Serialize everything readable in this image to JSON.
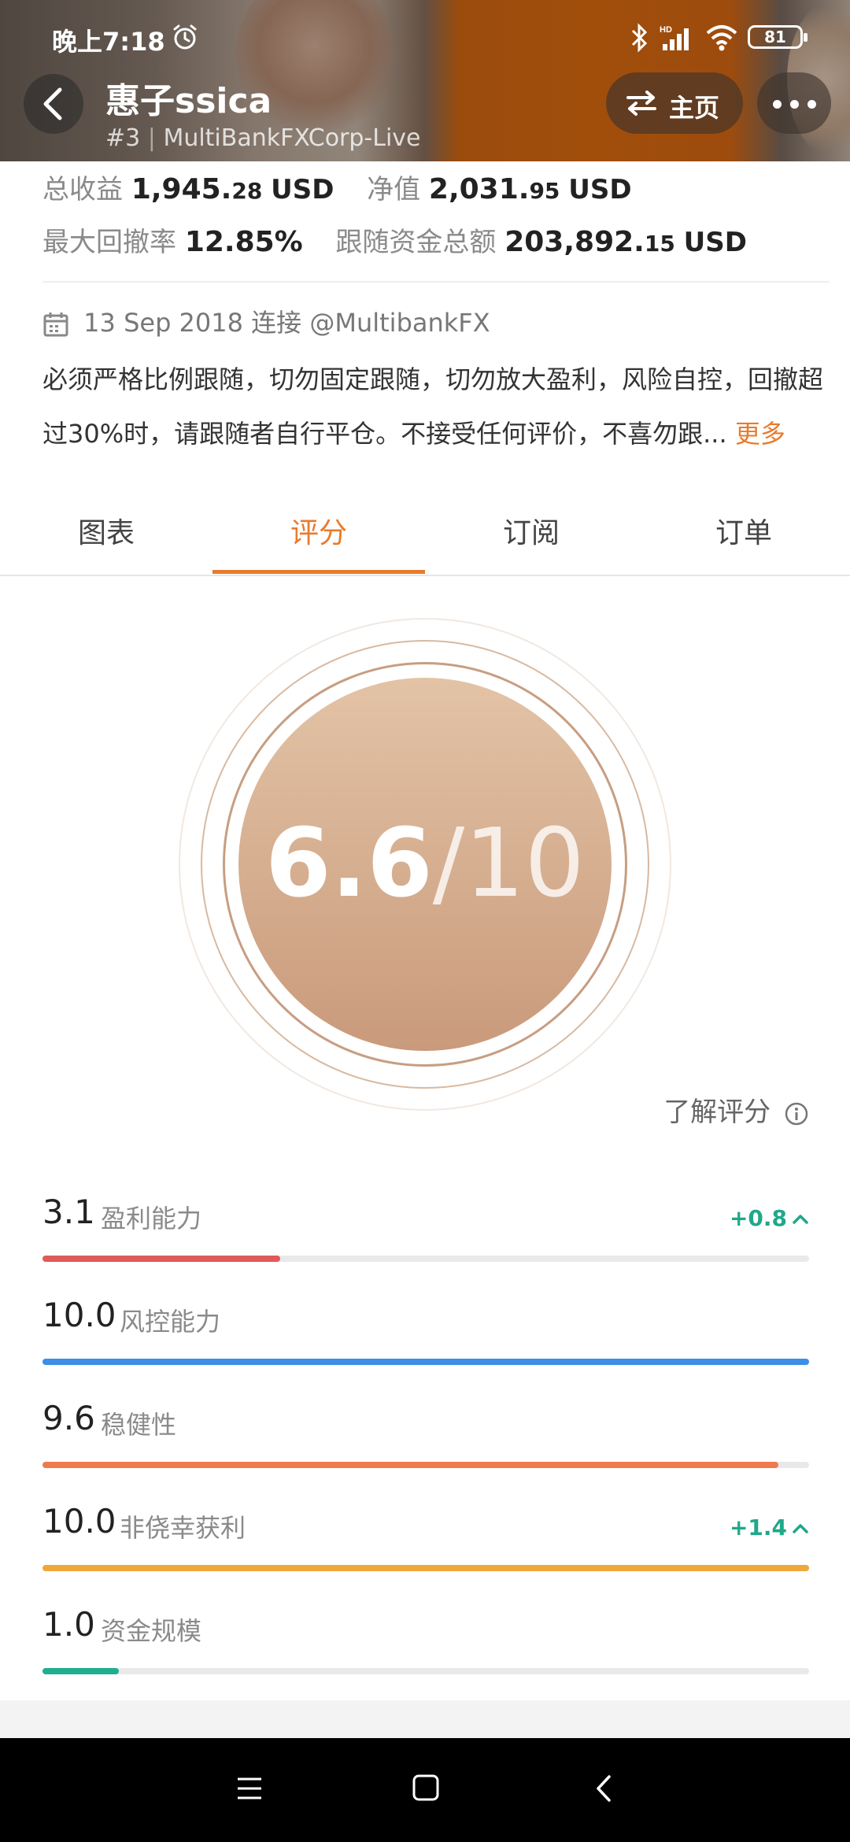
{
  "status_bar": {
    "time": "晚上7:18",
    "battery": "81"
  },
  "header": {
    "trader_name": "惠子ssica",
    "rank": "#3",
    "server": "MultiBankFXCorp-Live",
    "home_label": "主页"
  },
  "stats": {
    "total_profit_label": "总收益",
    "total_profit_int": "1,945.",
    "total_profit_dec": "28",
    "total_profit_unit": "USD",
    "equity_label": "净值",
    "equity_int": "2,031.",
    "equity_dec": "95",
    "equity_unit": "USD",
    "max_drawdown_label": "最大回撤率",
    "max_drawdown": "12.85%",
    "follow_funds_label": "跟随资金总额",
    "follow_funds_int": "203,892.",
    "follow_funds_dec": "15",
    "follow_funds_unit": "USD"
  },
  "info": {
    "date": "13 Sep 2018",
    "connect_label": "连接",
    "broker_handle": "@MultibankFX",
    "description": "必须严格比例跟随，切勿固定跟随，切勿放大盈利，风险自控，回撤超过30%时，请跟随者自行平仓。不接受任何评价，不喜勿跟...",
    "more_label": "更多"
  },
  "tabs": [
    {
      "label": "图表"
    },
    {
      "label": "评分"
    },
    {
      "label": "订阅"
    },
    {
      "label": "订单"
    }
  ],
  "active_tab": "评分",
  "score": {
    "value": "6.6",
    "denominator": "/10"
  },
  "learn_label": "了解评分",
  "metrics": [
    {
      "value": "3.1",
      "label": "盈利能力",
      "delta": "+0.8",
      "color": "#e05a5a",
      "fraction": 0.31
    },
    {
      "value": "10.0",
      "label": "风控能力",
      "delta": "",
      "color": "#3c8ee8",
      "fraction": 1.0
    },
    {
      "value": "9.6",
      "label": "稳健性",
      "delta": "",
      "color": "#ef7a4d",
      "fraction": 0.96
    },
    {
      "value": "10.0",
      "label": "非侥幸获利",
      "delta": "+1.4",
      "color": "#f0a73a",
      "fraction": 1.0
    },
    {
      "value": "1.0",
      "label": "资金规模",
      "delta": "",
      "color": "#1fae8f",
      "fraction": 0.1
    }
  ],
  "colors": {
    "accent": "#e87b2c",
    "positive": "#1fa88a"
  }
}
